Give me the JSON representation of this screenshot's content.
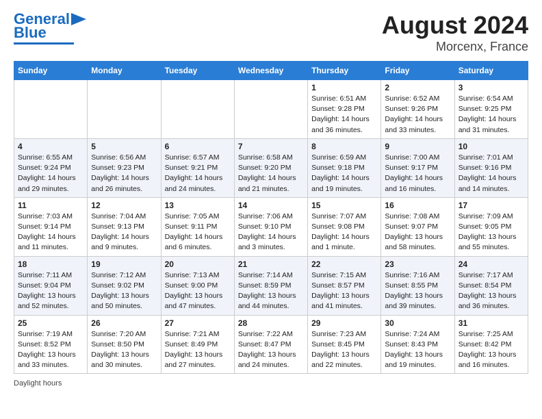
{
  "logo": {
    "line1": "General",
    "line2": "Blue"
  },
  "title": "August 2024",
  "subtitle": "Morcenx, France",
  "days": [
    "Sunday",
    "Monday",
    "Tuesday",
    "Wednesday",
    "Thursday",
    "Friday",
    "Saturday"
  ],
  "weeks": [
    [
      {
        "num": "",
        "text": ""
      },
      {
        "num": "",
        "text": ""
      },
      {
        "num": "",
        "text": ""
      },
      {
        "num": "",
        "text": ""
      },
      {
        "num": "1",
        "text": "Sunrise: 6:51 AM\nSunset: 9:28 PM\nDaylight: 14 hours\nand 36 minutes."
      },
      {
        "num": "2",
        "text": "Sunrise: 6:52 AM\nSunset: 9:26 PM\nDaylight: 14 hours\nand 33 minutes."
      },
      {
        "num": "3",
        "text": "Sunrise: 6:54 AM\nSunset: 9:25 PM\nDaylight: 14 hours\nand 31 minutes."
      }
    ],
    [
      {
        "num": "4",
        "text": "Sunrise: 6:55 AM\nSunset: 9:24 PM\nDaylight: 14 hours\nand 29 minutes."
      },
      {
        "num": "5",
        "text": "Sunrise: 6:56 AM\nSunset: 9:23 PM\nDaylight: 14 hours\nand 26 minutes."
      },
      {
        "num": "6",
        "text": "Sunrise: 6:57 AM\nSunset: 9:21 PM\nDaylight: 14 hours\nand 24 minutes."
      },
      {
        "num": "7",
        "text": "Sunrise: 6:58 AM\nSunset: 9:20 PM\nDaylight: 14 hours\nand 21 minutes."
      },
      {
        "num": "8",
        "text": "Sunrise: 6:59 AM\nSunset: 9:18 PM\nDaylight: 14 hours\nand 19 minutes."
      },
      {
        "num": "9",
        "text": "Sunrise: 7:00 AM\nSunset: 9:17 PM\nDaylight: 14 hours\nand 16 minutes."
      },
      {
        "num": "10",
        "text": "Sunrise: 7:01 AM\nSunset: 9:16 PM\nDaylight: 14 hours\nand 14 minutes."
      }
    ],
    [
      {
        "num": "11",
        "text": "Sunrise: 7:03 AM\nSunset: 9:14 PM\nDaylight: 14 hours\nand 11 minutes."
      },
      {
        "num": "12",
        "text": "Sunrise: 7:04 AM\nSunset: 9:13 PM\nDaylight: 14 hours\nand 9 minutes."
      },
      {
        "num": "13",
        "text": "Sunrise: 7:05 AM\nSunset: 9:11 PM\nDaylight: 14 hours\nand 6 minutes."
      },
      {
        "num": "14",
        "text": "Sunrise: 7:06 AM\nSunset: 9:10 PM\nDaylight: 14 hours\nand 3 minutes."
      },
      {
        "num": "15",
        "text": "Sunrise: 7:07 AM\nSunset: 9:08 PM\nDaylight: 14 hours\nand 1 minute."
      },
      {
        "num": "16",
        "text": "Sunrise: 7:08 AM\nSunset: 9:07 PM\nDaylight: 13 hours\nand 58 minutes."
      },
      {
        "num": "17",
        "text": "Sunrise: 7:09 AM\nSunset: 9:05 PM\nDaylight: 13 hours\nand 55 minutes."
      }
    ],
    [
      {
        "num": "18",
        "text": "Sunrise: 7:11 AM\nSunset: 9:04 PM\nDaylight: 13 hours\nand 52 minutes."
      },
      {
        "num": "19",
        "text": "Sunrise: 7:12 AM\nSunset: 9:02 PM\nDaylight: 13 hours\nand 50 minutes."
      },
      {
        "num": "20",
        "text": "Sunrise: 7:13 AM\nSunset: 9:00 PM\nDaylight: 13 hours\nand 47 minutes."
      },
      {
        "num": "21",
        "text": "Sunrise: 7:14 AM\nSunset: 8:59 PM\nDaylight: 13 hours\nand 44 minutes."
      },
      {
        "num": "22",
        "text": "Sunrise: 7:15 AM\nSunset: 8:57 PM\nDaylight: 13 hours\nand 41 minutes."
      },
      {
        "num": "23",
        "text": "Sunrise: 7:16 AM\nSunset: 8:55 PM\nDaylight: 13 hours\nand 39 minutes."
      },
      {
        "num": "24",
        "text": "Sunrise: 7:17 AM\nSunset: 8:54 PM\nDaylight: 13 hours\nand 36 minutes."
      }
    ],
    [
      {
        "num": "25",
        "text": "Sunrise: 7:19 AM\nSunset: 8:52 PM\nDaylight: 13 hours\nand 33 minutes."
      },
      {
        "num": "26",
        "text": "Sunrise: 7:20 AM\nSunset: 8:50 PM\nDaylight: 13 hours\nand 30 minutes."
      },
      {
        "num": "27",
        "text": "Sunrise: 7:21 AM\nSunset: 8:49 PM\nDaylight: 13 hours\nand 27 minutes."
      },
      {
        "num": "28",
        "text": "Sunrise: 7:22 AM\nSunset: 8:47 PM\nDaylight: 13 hours\nand 24 minutes."
      },
      {
        "num": "29",
        "text": "Sunrise: 7:23 AM\nSunset: 8:45 PM\nDaylight: 13 hours\nand 22 minutes."
      },
      {
        "num": "30",
        "text": "Sunrise: 7:24 AM\nSunset: 8:43 PM\nDaylight: 13 hours\nand 19 minutes."
      },
      {
        "num": "31",
        "text": "Sunrise: 7:25 AM\nSunset: 8:42 PM\nDaylight: 13 hours\nand 16 minutes."
      }
    ]
  ],
  "footer": "Daylight hours"
}
